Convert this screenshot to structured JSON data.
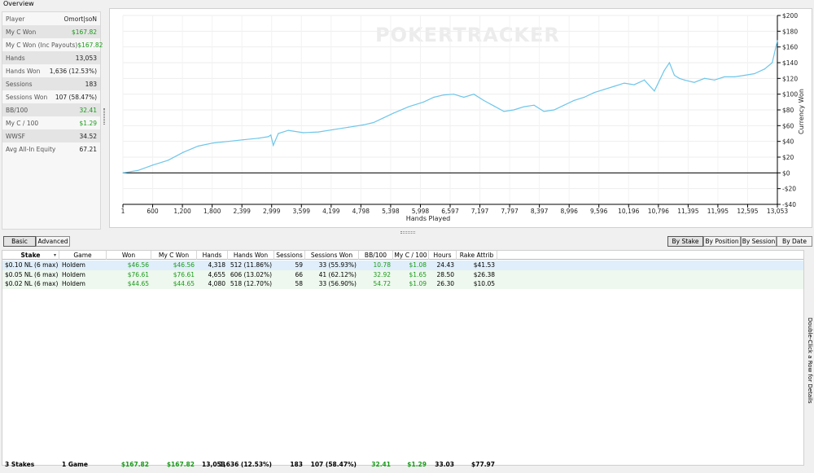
{
  "overview": {
    "title": "Overview",
    "stats": [
      {
        "label": "Player",
        "value": "Omort|soN",
        "green": false
      },
      {
        "label": "My C Won",
        "value": "$167.82",
        "green": true
      },
      {
        "label": "My C Won (Inc Payouts)",
        "value": "$167.82",
        "green": true
      },
      {
        "label": "Hands",
        "value": "13,053",
        "green": false
      },
      {
        "label": "Hands Won",
        "value": "1,636 (12.53%)",
        "green": false
      },
      {
        "label": "Sessions",
        "value": "183",
        "green": false
      },
      {
        "label": "Sessions Won",
        "value": "107 (58.47%)",
        "green": false
      },
      {
        "label": "BB/100",
        "value": "32.41",
        "green": true
      },
      {
        "label": "My C / 100",
        "value": "$1.29",
        "green": true
      },
      {
        "label": "WWSF",
        "value": "34.52",
        "green": false
      },
      {
        "label": "Avg All-In Equity",
        "value": "67.21",
        "green": false
      }
    ]
  },
  "chart_data": {
    "type": "line",
    "watermark": "POKERTRACKER",
    "xlabel": "Hands Played",
    "ylabel": "Currency Won",
    "x_ticks": [
      "1",
      "600",
      "1,200",
      "1,800",
      "2,399",
      "2,999",
      "3,599",
      "4,199",
      "4,798",
      "5,398",
      "5,998",
      "6,597",
      "7,197",
      "7,797",
      "8,397",
      "8,996",
      "9,596",
      "10,196",
      "10,796",
      "11,395",
      "11,995",
      "12,595",
      "13,053"
    ],
    "y_ticks": [
      "$200",
      "$180",
      "$160",
      "$140",
      "$120",
      "$100",
      "$80",
      "$60",
      "$40",
      "$20",
      "$0",
      "-$20",
      "-$40"
    ],
    "xlim": [
      1,
      13053
    ],
    "ylim": [
      -40,
      200
    ],
    "series": [
      {
        "color": "#6ec6ea",
        "x": [
          1,
          300,
          600,
          900,
          1200,
          1500,
          1800,
          2100,
          2399,
          2700,
          2900,
          2950,
          3000,
          3100,
          3300,
          3599,
          3900,
          4199,
          4500,
          4798,
          5000,
          5200,
          5398,
          5700,
          5998,
          6200,
          6400,
          6597,
          6800,
          7000,
          7197,
          7400,
          7600,
          7797,
          8000,
          8200,
          8397,
          8600,
          8800,
          8996,
          9200,
          9400,
          9596,
          9800,
          10000,
          10196,
          10400,
          10600,
          10796,
          10900,
          11000,
          11100,
          11200,
          11395,
          11600,
          11800,
          11995,
          12200,
          12400,
          12595,
          12800,
          12950,
          13053
        ],
        "values": [
          0,
          3,
          10,
          16,
          26,
          34,
          38,
          40,
          42,
          44,
          46,
          48,
          35,
          50,
          54,
          51,
          52,
          55,
          58,
          61,
          64,
          70,
          76,
          84,
          90,
          96,
          99,
          100,
          96,
          100,
          92,
          85,
          78,
          80,
          84,
          86,
          78,
          80,
          86,
          92,
          96,
          102,
          106,
          110,
          114,
          112,
          118,
          104,
          130,
          140,
          124,
          120,
          118,
          115,
          120,
          118,
          122,
          122,
          124,
          126,
          132,
          140,
          168
        ]
      }
    ]
  },
  "tabs_left": [
    "Basic",
    "Advanced"
  ],
  "tabs_right": [
    "By Stake",
    "By Position",
    "By Session",
    "By Date"
  ],
  "grid": {
    "columns": [
      "Stake",
      "Game",
      "Won",
      "My C Won",
      "Hands",
      "Hands Won",
      "Sessions",
      "Sessions Won",
      "BB/100",
      "My C / 100",
      "Hours",
      "Rake Attrib"
    ],
    "rows": [
      [
        "$0.10 NL (6 max)",
        "Holdem",
        "$46.56",
        "$46.56",
        "4,318",
        "512 (11.86%)",
        "59",
        "33 (55.93%)",
        "10.78",
        "$1.08",
        "24.43",
        "$41.53"
      ],
      [
        "$0.05 NL (6 max)",
        "Holdem",
        "$76.61",
        "$76.61",
        "4,655",
        "606 (13.02%)",
        "66",
        "41 (62.12%)",
        "32.92",
        "$1.65",
        "28.50",
        "$26.38"
      ],
      [
        "$0.02 NL (6 max)",
        "Holdem",
        "$44.65",
        "$44.65",
        "4,080",
        "518 (12.70%)",
        "58",
        "33 (56.90%)",
        "54.72",
        "$1.09",
        "26.30",
        "$10.05"
      ]
    ],
    "summary": [
      "3 Stakes",
      "1 Game",
      "$167.82",
      "$167.82",
      "13,053",
      "1,636 (12.53%)",
      "183",
      "107 (58.47%)",
      "32.41",
      "$1.29",
      "33.03",
      "$77.97"
    ]
  },
  "side_note": "Double-Click a Row for Details"
}
